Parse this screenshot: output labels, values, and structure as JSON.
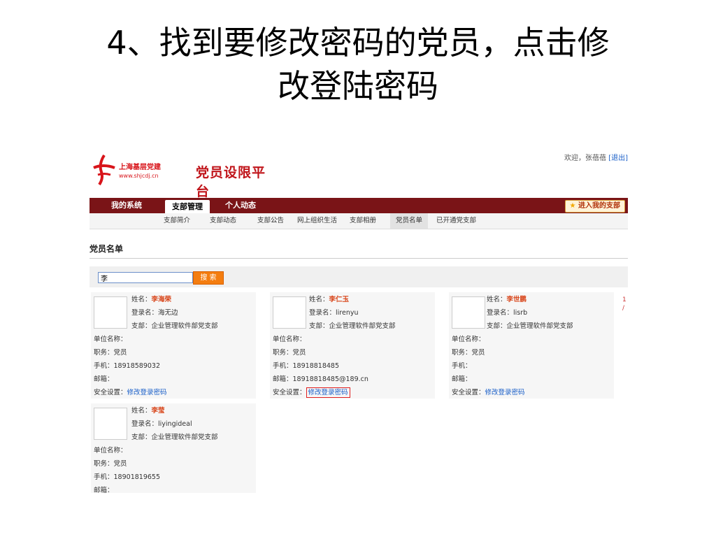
{
  "slide": {
    "title_line1": "4、找到要修改密码的党员，点击修",
    "title_line2": "改登陆密码"
  },
  "header": {
    "logo_small": "上海基层党建",
    "logo_url": "www.shjcdj.cn",
    "platform_name": "党员设限平台",
    "welcome": "欢迎，张蓓蓓",
    "logout": "[退出]"
  },
  "nav": {
    "tabs": [
      "我的系统",
      "支部管理",
      "个人动态"
    ],
    "active_tab": "支部管理",
    "enter_button": "进入我的支部"
  },
  "subnav": {
    "items": [
      "支部简介",
      "支部动态",
      "支部公告",
      "网上组织生活",
      "支部相册",
      "党员名单",
      "已开通党支部"
    ],
    "active": "党员名单"
  },
  "page": {
    "title": "党员名单"
  },
  "search": {
    "value": "李",
    "button": "搜 索"
  },
  "labels": {
    "name": "姓名：",
    "login": "登录名：",
    "branch": "支部：",
    "unit": "单位名称：",
    "duty": "职务：",
    "phone": "手机：",
    "email": "邮箱：",
    "security": "安全设置："
  },
  "members": [
    {
      "name": "李海荣",
      "login": "海无边",
      "branch": "企业管理软件部党支部",
      "unit": "",
      "duty": "党员",
      "phone": "18918589032",
      "email": "",
      "security_link": "修改登录密码",
      "highlighted": false
    },
    {
      "name": "李仁玉",
      "login": "lirenyu",
      "branch": "企业管理软件部党支部",
      "unit": "",
      "duty": "党员",
      "phone": "18918818485",
      "email": "18918818485@189.cn",
      "security_link": "修改登录密码",
      "highlighted": true
    },
    {
      "name": "李世鹏",
      "login": "lisrb",
      "branch": "企业管理软件部党支部",
      "unit": "",
      "duty": "党员",
      "phone": "",
      "email": "",
      "security_link": "修改登录密码",
      "highlighted": false
    },
    {
      "name": "李莹",
      "login": "liyingideal",
      "branch": "企业管理软件部党支部",
      "unit": "",
      "duty": "党员",
      "phone": "18901819655",
      "email": "",
      "security_link": "",
      "highlighted": false
    }
  ],
  "edge_text": [
    "1",
    "/"
  ],
  "colors": {
    "nav_bg": "#7a1417",
    "brand_red": "#c0141a",
    "search_button": "#f47d10",
    "link": "#1a5fc8",
    "highlight_border": "#e02020"
  }
}
